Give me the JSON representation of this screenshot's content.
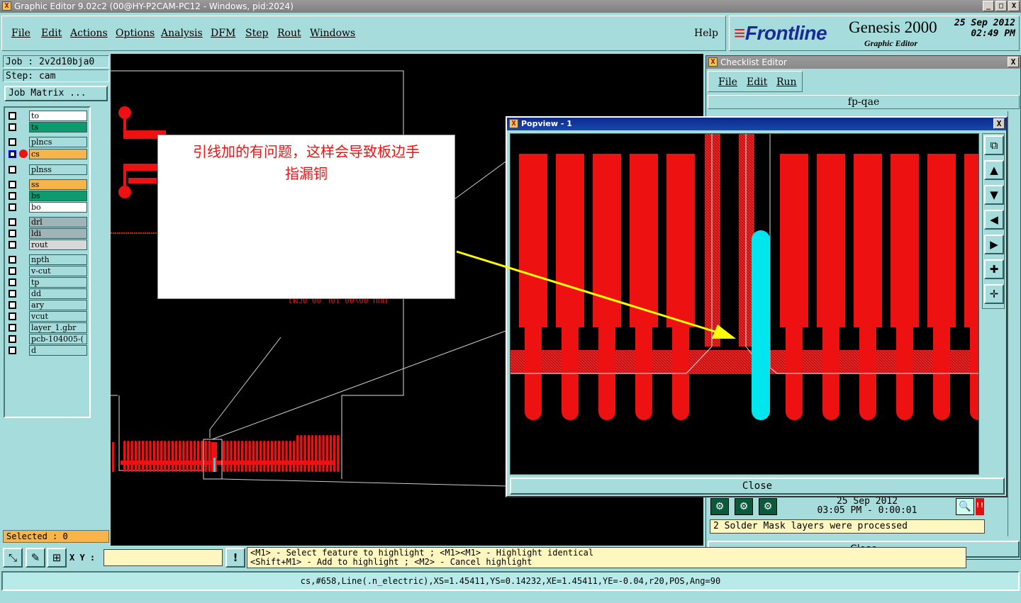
{
  "window": {
    "title": "Graphic Editor 9.02c2 (00@HY-P2CAM-PC12 - Windows, pid:2024)",
    "buttons": [
      "_",
      "□",
      "X"
    ]
  },
  "menu": {
    "items": [
      "File",
      "Edit",
      "Actions",
      "Options",
      "Analysis",
      "DFM",
      "Step",
      "Rout",
      "Windows"
    ],
    "help": "Help"
  },
  "brand": {
    "logo": "Frontline",
    "product": "Genesis 2000",
    "subtitle": "Graphic Editor",
    "date": "25 Sep 2012",
    "time": "02:49 PM"
  },
  "left_panel": {
    "job": "Job : 2v2d10bja0",
    "step": "Step: cam",
    "job_matrix": "Job Matrix ...",
    "layers": [
      {
        "name": "to",
        "color": "#ffffff",
        "checked": false
      },
      {
        "name": "ts",
        "color": "#0f9a6e",
        "checked": false
      },
      {
        "name": "plncs",
        "color": "#a6dcdc",
        "checked": false
      },
      {
        "name": "cs",
        "color": "#f7b44a",
        "checked": true,
        "active": true
      },
      {
        "name": "plnss",
        "color": "#a6dcdc",
        "checked": false
      },
      {
        "name": "ss",
        "color": "#f7b44a",
        "checked": false
      },
      {
        "name": "bs",
        "color": "#0f9a6e",
        "checked": false
      },
      {
        "name": "bo",
        "color": "#ffffff",
        "checked": false
      },
      {
        "name": "drl",
        "color": "#a0b4b8",
        "checked": false
      },
      {
        "name": "ldi",
        "color": "#a0b4b8",
        "checked": false
      },
      {
        "name": "rout",
        "color": "#d8d8d8",
        "checked": false
      },
      {
        "name": "npth",
        "color": "#a6dcdc",
        "checked": false
      },
      {
        "name": "v-cut",
        "color": "#a6dcdc",
        "checked": false
      },
      {
        "name": "tp",
        "color": "#a6dcdc",
        "checked": false
      },
      {
        "name": "dd",
        "color": "#a6dcdc",
        "checked": false
      },
      {
        "name": "ary",
        "color": "#a6dcdc",
        "checked": false
      },
      {
        "name": "vcut",
        "color": "#a6dcdc",
        "checked": false
      },
      {
        "name": "layer_1.gbr",
        "color": "#a6dcdc",
        "checked": false
      },
      {
        "name": "pcb-104005-(",
        "color": "#a6dcdc",
        "checked": false
      },
      {
        "name": "d",
        "color": "#a6dcdc",
        "checked": false
      }
    ],
    "selected": "Selected : 0"
  },
  "annotation": {
    "text_line1": "引线加的有问题，这样会导致板边手",
    "text_line2": "指漏铜",
    "arrow_color": "#ffff00"
  },
  "canvas_text": "UUU 00\\00 10L 00 0CMJ",
  "checklist": {
    "title": "Checklist Editor",
    "menu": [
      "File",
      "Edit",
      "Run"
    ],
    "name": "fp-qae",
    "date": "25 Sep 2012",
    "time_line": "03:05 PM - 0:00:01",
    "message": "2 Solder Mask layers were processed",
    "close": "Close"
  },
  "popview": {
    "title": "Popview - 1",
    "close": "Close",
    "highlight_color": "#00e5ee",
    "copper_color": "#ee1111"
  },
  "bottom": {
    "xy_label": "X Y :",
    "xy_value": "",
    "hint_line1": "<M1> - Select feature to highlight ; <M1><M1> - Highlight identical",
    "hint_line2": "<Shift+M1> - Add to highlight ; <M2> - Cancel highlight",
    "status": "cs,#658,Line(.n_electric),XS=1.45411,YS=0.14232,XE=1.45411,YE=-0.04,r20,POS,Ang=90"
  }
}
